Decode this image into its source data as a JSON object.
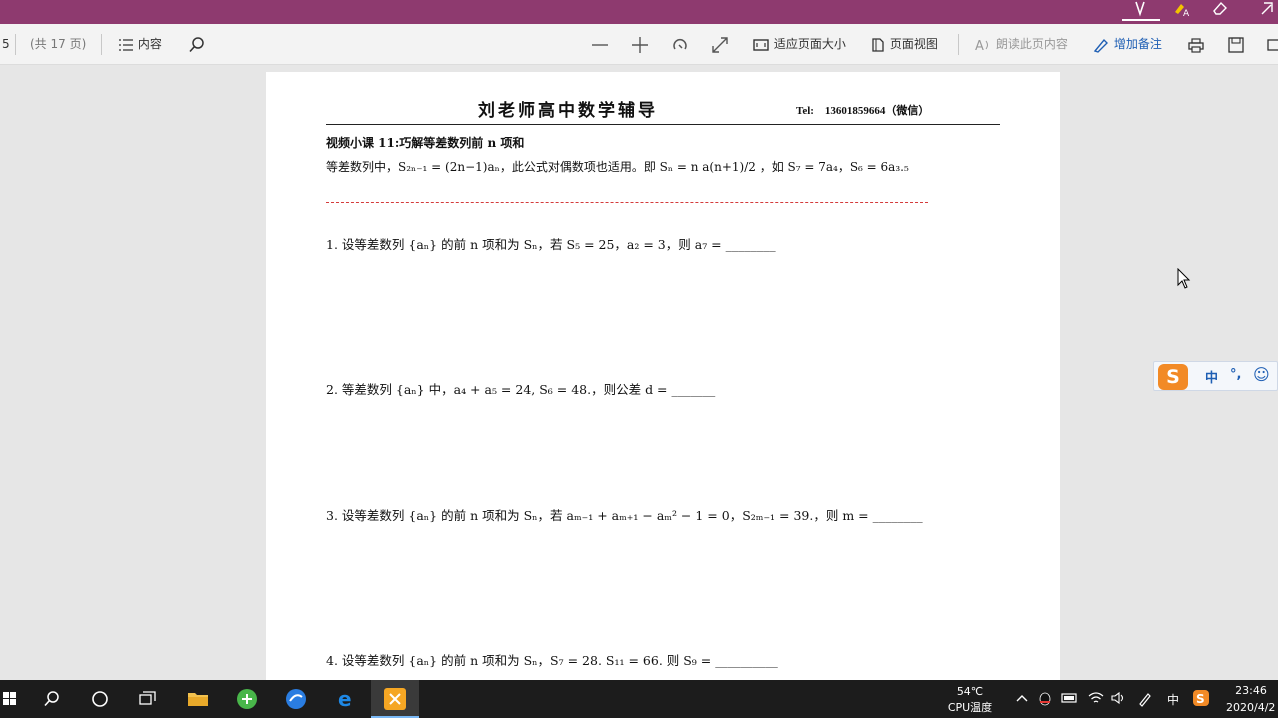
{
  "titlebar": {
    "icons": [
      "pen-icon",
      "highlight-icon",
      "eraser-icon",
      "share-icon"
    ],
    "highlight_label": "A"
  },
  "toolbar": {
    "page_partial": "5",
    "page_total": "(共 17 页)",
    "contents_label": "内容",
    "fit_page_label": "适应页面大小",
    "page_view_label": "页面视图",
    "read_aloud_label": "朗读此页内容",
    "add_notes_label": "增加备注"
  },
  "document": {
    "title": "刘老师高中数学辅导",
    "tel": "Tel:　13601859664（微信）",
    "lesson_title": "视频小课 11:巧解等差数列前 n 项和",
    "formula_line": "等差数列中，S₂ₙ₋₁ = (2n−1)aₙ，此公式对偶数项也适用。即 Sₙ = n a(n+1)/2 ，如 S₇ = 7a₄，S₆ = 6a₃.₅",
    "problems": [
      "1. 设等差数列 {aₙ} 的前 n 项和为 Sₙ，若 S₅ = 25，a₂ = 3，则 a₇ = ________",
      "2. 等差数列 {aₙ} 中，a₄ + a₅ = 24, S₆ = 48.，则公差 d = _______",
      "3. 设等差数列 {aₙ} 的前 n 项和为 Sₙ，若 aₘ₋₁ + aₘ₊₁ − aₘ² − 1 = 0，S₂ₘ₋₁ = 39.，则 m = ________",
      "4. 设等差数列 {aₙ} 的前 n 项和为 Sₙ，S₇ = 28. S₁₁ = 66. 则 S₉ = __________"
    ]
  },
  "ime": {
    "logo": "S",
    "mode": "中",
    "punct": "°,",
    "emoji": "☺"
  },
  "taskbar": {
    "apps": [
      "start-icon",
      "search-icon",
      "cortana-icon",
      "task-view-icon",
      "file-explorer-icon",
      "green-app-icon",
      "blue-app-icon",
      "edge-icon",
      "orange-app-icon"
    ],
    "cpu_temp": "54℃",
    "cpu_label": "CPU温度",
    "ime_indicator": "中",
    "time": "23:46",
    "date": "2020/4/2"
  },
  "colors": {
    "titlebar": "#8e3a6f",
    "accent_blue": "#1f5fb4",
    "dash_red": "#d43b3b",
    "taskbar": "#1c1c1c"
  }
}
